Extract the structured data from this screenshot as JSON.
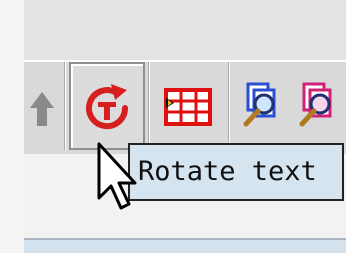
{
  "toolbar": {
    "buttons": [
      {
        "icon": "up-arrow-icon",
        "state": "normal"
      },
      {
        "icon": "rotate-text-icon",
        "state": "hovered"
      },
      {
        "icon": "table-icon",
        "state": "normal"
      },
      {
        "icon": "document-search-blue-icon",
        "state": "normal"
      },
      {
        "icon": "document-search-pink-icon",
        "state": "normal"
      }
    ]
  },
  "tooltip": {
    "text": "Rotate text"
  },
  "colors": {
    "rotate_red": "#d62020",
    "table_red": "#e01010",
    "tooltip_bg": "#d6e4f0",
    "toolbar_bg": "#d9d9d9"
  },
  "cursor": {
    "icon": "mouse-pointer-icon"
  }
}
